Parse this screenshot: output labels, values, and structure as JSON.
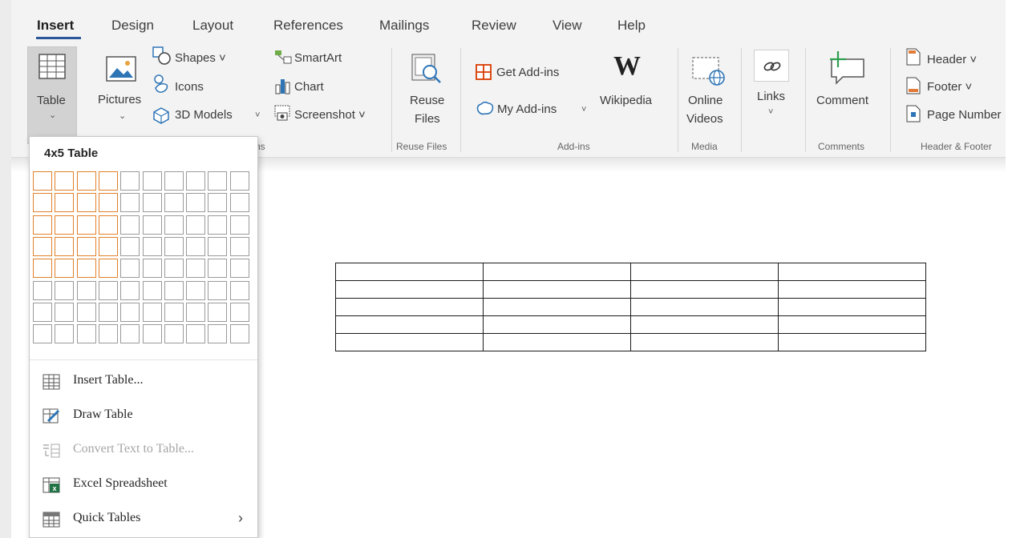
{
  "tabs": [
    {
      "label": "Insert",
      "active": true
    },
    {
      "label": "Design"
    },
    {
      "label": "Layout"
    },
    {
      "label": "References"
    },
    {
      "label": "Mailings"
    },
    {
      "label": "Review"
    },
    {
      "label": "View"
    },
    {
      "label": "Help"
    }
  ],
  "ribbon": {
    "table": {
      "label": "Table",
      "chevron": "⌄"
    },
    "pictures": {
      "label": "Pictures",
      "chevron": "⌄"
    },
    "shapes": {
      "label": "Shapes ˅"
    },
    "icons": {
      "label": "Icons"
    },
    "models": {
      "label": "3D Models",
      "chevron": "˅"
    },
    "smartart": {
      "label": "SmartArt"
    },
    "chart": {
      "label": "Chart"
    },
    "screenshot": {
      "label": "Screenshot ˅"
    },
    "illustrations_group_partial": "ns",
    "reuse": {
      "line1": "Reuse",
      "line2": "Files"
    },
    "reuse_group": "Reuse Files",
    "get_addins": {
      "label": "Get Add-ins"
    },
    "my_addins": {
      "label": "My Add-ins",
      "chevron": "˅"
    },
    "wikipedia": {
      "label": "Wikipedia"
    },
    "addins_group": "Add-ins",
    "online_videos": {
      "line1": "Online",
      "line2": "Videos"
    },
    "media_group": "Media",
    "links": {
      "label": "Links",
      "chevron": "˅"
    },
    "comment": {
      "label": "Comment"
    },
    "comments_group": "Comments",
    "header": {
      "label": "Header ˅"
    },
    "footer": {
      "label": "Footer ˅"
    },
    "page_number": {
      "label": "Page Number"
    },
    "header_footer_group": "Header & Footer"
  },
  "dropdown": {
    "title": "4x5 Table",
    "grid": {
      "cols": 10,
      "rows": 8,
      "selected_cols": 4,
      "selected_rows": 5
    },
    "items": [
      {
        "label": "Insert Table...",
        "icon": "table-icon",
        "disabled": false
      },
      {
        "label": "Draw Table",
        "icon": "pencil-table-icon",
        "disabled": false
      },
      {
        "label": "Convert Text to Table...",
        "icon": "convert-text-icon",
        "disabled": true
      },
      {
        "label": "Excel Spreadsheet",
        "icon": "excel-icon",
        "disabled": false
      },
      {
        "label": "Quick Tables",
        "icon": "quick-table-icon",
        "disabled": false,
        "submenu": "›"
      }
    ]
  },
  "document_table": {
    "rows": 5,
    "cols": 4
  },
  "colors": {
    "accent": "#2b579a",
    "grid_selected": "#e0802b",
    "excel_green": "#217346",
    "addins_red": "#d83b01"
  }
}
